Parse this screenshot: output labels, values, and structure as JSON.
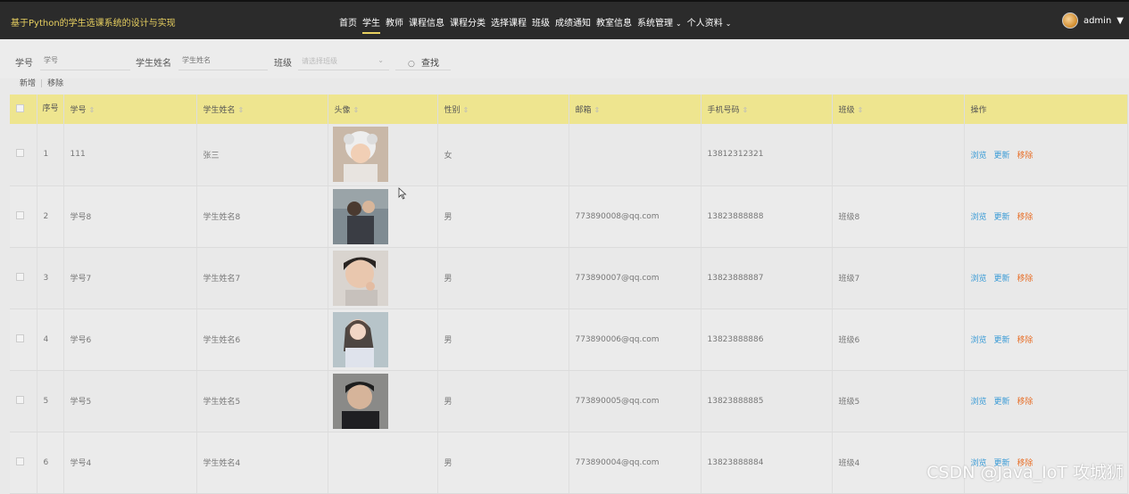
{
  "header": {
    "brand": "基于Python的学生选课系统的设计与实现",
    "nav": [
      {
        "label": "首页"
      },
      {
        "label": "学生",
        "active": true
      },
      {
        "label": "教师"
      },
      {
        "label": "课程信息"
      },
      {
        "label": "课程分类"
      },
      {
        "label": "选择课程"
      },
      {
        "label": "班级"
      },
      {
        "label": "成绩通知"
      },
      {
        "label": "教室信息"
      },
      {
        "label": "系统管理",
        "dropdown": true
      },
      {
        "label": "个人资料",
        "dropdown": true
      }
    ],
    "user": "admin"
  },
  "search": {
    "student_no_label": "学号",
    "student_no_placeholder": "学号",
    "student_name_label": "学生姓名",
    "student_name_placeholder": "学生姓名",
    "class_label": "班级",
    "class_placeholder": "请选择班级",
    "search_button": "查找"
  },
  "ops": {
    "add": "新增",
    "sep": "|",
    "remove": "移除"
  },
  "table": {
    "headers": {
      "index": "序号",
      "student_no": "学号",
      "name": "学生姓名",
      "photo": "头像",
      "gender": "性别",
      "email": "邮箱",
      "phone": "手机号码",
      "class": "班级",
      "actions": "操作"
    },
    "rows": [
      {
        "index": "1",
        "student_no": "111",
        "name": "张三",
        "gender": "女",
        "email": "",
        "phone": "13812312321",
        "class": "",
        "photo": "photo-1"
      },
      {
        "index": "2",
        "student_no": "学号8",
        "name": "学生姓名8",
        "gender": "男",
        "email": "773890008@qq.com",
        "phone": "13823888888",
        "class": "班级8",
        "photo": "photo-2"
      },
      {
        "index": "3",
        "student_no": "学号7",
        "name": "学生姓名7",
        "gender": "男",
        "email": "773890007@qq.com",
        "phone": "13823888887",
        "class": "班级7",
        "photo": "photo-3"
      },
      {
        "index": "4",
        "student_no": "学号6",
        "name": "学生姓名6",
        "gender": "男",
        "email": "773890006@qq.com",
        "phone": "13823888886",
        "class": "班级6",
        "photo": "photo-4"
      },
      {
        "index": "5",
        "student_no": "学号5",
        "name": "学生姓名5",
        "gender": "男",
        "email": "773890005@qq.com",
        "phone": "13823888885",
        "class": "班级5",
        "photo": "photo-5"
      },
      {
        "index": "6",
        "student_no": "学号4",
        "name": "学生姓名4",
        "gender": "男",
        "email": "773890004@qq.com",
        "phone": "13823888884",
        "class": "班级4",
        "photo": ""
      }
    ],
    "action_labels": {
      "view": "浏览",
      "update": "更新",
      "remove": "移除"
    }
  },
  "watermark": "CSDN @Java_IoT 攻城狮",
  "colors": {
    "header_bg": "#2b2b2b",
    "brand": "#e8d060",
    "table_header": "#eee58f",
    "link": "#3a9bd6",
    "danger": "#e8702a"
  }
}
